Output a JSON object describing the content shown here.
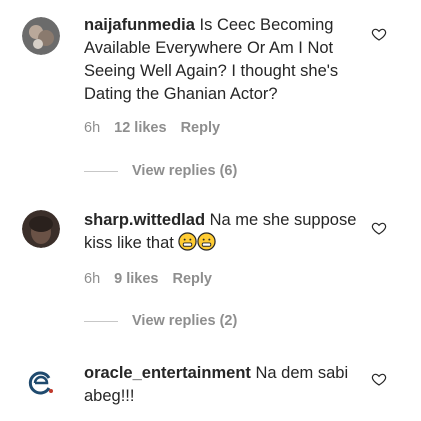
{
  "comments": [
    {
      "username": "naijafunmedia",
      "text": " Is Ceec Becoming Available Everywhere Or Am I Not Seeing Well Again? I thought she's Dating the Ghanian Actor?",
      "time": "6h",
      "likes": "12 likes",
      "reply": "Reply",
      "view_replies": "View replies (6)"
    },
    {
      "username": "sharp.wittedlad",
      "text": " Na me she suppose kiss like that ",
      "emojis": [
        "grimacing-face",
        "grimacing-face"
      ],
      "time": "6h",
      "likes": "9 likes",
      "reply": "Reply",
      "view_replies": "View replies (2)"
    },
    {
      "username": "oracle_entertainment",
      "text": " Na dem sabi abeg!!!"
    }
  ],
  "colors": {
    "text": "#262626",
    "muted": "#8e8e8e",
    "line": "#c7c7c7"
  }
}
